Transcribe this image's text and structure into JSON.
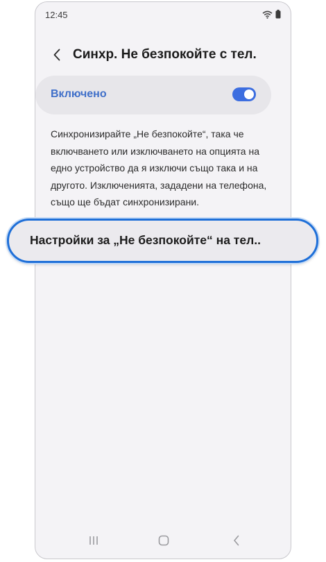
{
  "status_bar": {
    "time": "12:45",
    "icons": [
      "wifi-icon",
      "battery-icon"
    ]
  },
  "header": {
    "back_icon": "chevron-left-icon",
    "title": "Синхр. Не безпокойте с тел."
  },
  "toggle": {
    "label": "Включено",
    "state": "on",
    "accent_color": "#3d6ee0"
  },
  "description": "Синхронизирайте „Не безпокойте“, така че включването или изключването на опцията на едно устройство да я изключи също така и на другото. Изключенията, зададени на телефона, също ще бъдат синхронизирани.",
  "callout": {
    "label": "Настройки за „Не безпокойте“ на тел..",
    "highlight_color": "#1e6fd8"
  },
  "nav_bar": {
    "buttons": [
      "recent-apps-icon",
      "home-icon",
      "back-icon"
    ]
  }
}
